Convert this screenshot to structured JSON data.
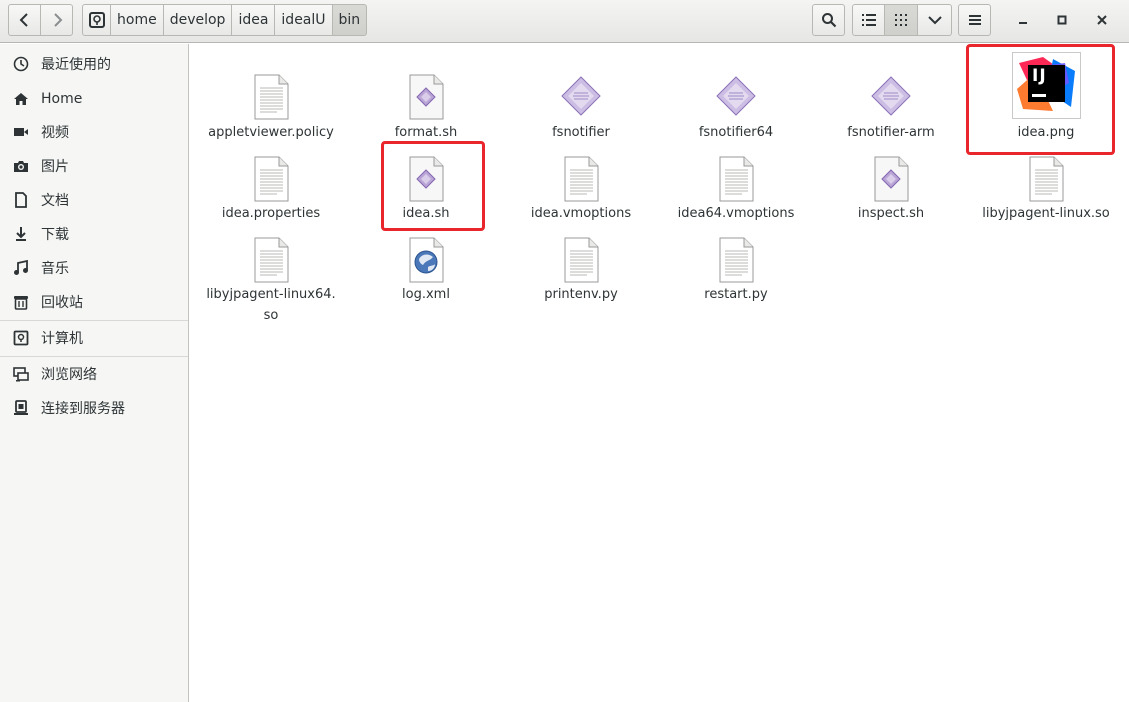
{
  "breadcrumb": [
    "home",
    "develop",
    "idea",
    "idealU",
    "bin"
  ],
  "sidebar": {
    "items": [
      {
        "label": "最近使用的",
        "icon": "recent-icon"
      },
      {
        "label": "Home",
        "icon": "home-icon"
      },
      {
        "label": "视频",
        "icon": "video-icon"
      },
      {
        "label": "图片",
        "icon": "camera-icon"
      },
      {
        "label": "文档",
        "icon": "document-icon"
      },
      {
        "label": "下载",
        "icon": "download-icon"
      },
      {
        "label": "音乐",
        "icon": "music-icon"
      },
      {
        "label": "回收站",
        "icon": "trash-icon"
      },
      {
        "label": "计算机",
        "icon": "computer-icon"
      },
      {
        "label": "浏览网络",
        "icon": "network-icon"
      },
      {
        "label": "连接到服务器",
        "icon": "server-icon"
      }
    ]
  },
  "files": [
    {
      "name": "appletviewer.policy",
      "icon": "text-file-icon"
    },
    {
      "name": "format.sh",
      "icon": "script-file-icon"
    },
    {
      "name": "fsnotifier",
      "icon": "executable-file-icon"
    },
    {
      "name": "fsnotifier64",
      "icon": "executable-file-icon"
    },
    {
      "name": "fsnotifier-arm",
      "icon": "executable-file-icon"
    },
    {
      "name": "idea.png",
      "icon": "intellij-image-icon"
    },
    {
      "name": "idea.properties",
      "icon": "text-file-icon"
    },
    {
      "name": "idea.sh",
      "icon": "script-file-icon"
    },
    {
      "name": "idea.vmoptions",
      "icon": "text-file-icon"
    },
    {
      "name": "idea64.vmoptions",
      "icon": "text-file-icon"
    },
    {
      "name": "inspect.sh",
      "icon": "script-file-icon"
    },
    {
      "name": "libyjpagent-linux.so",
      "icon": "text-file-icon"
    },
    {
      "name_line1": "libyjpagent-linux64.",
      "name_line2": "so",
      "icon": "text-file-icon"
    },
    {
      "name": "log.xml",
      "icon": "xml-file-icon"
    },
    {
      "name": "printenv.py",
      "icon": "text-file-icon"
    },
    {
      "name": "restart.py",
      "icon": "text-file-icon"
    }
  ],
  "logo_text": "IJ",
  "colors": {
    "highlight": "#e8262b",
    "diamond": "#9b7fbf"
  }
}
